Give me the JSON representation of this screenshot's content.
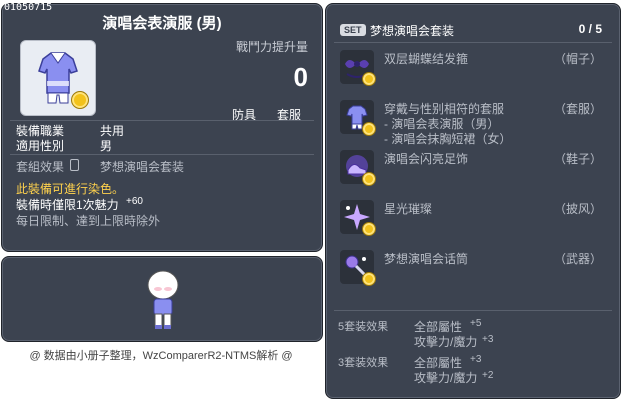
{
  "item": {
    "id_label": "01050715",
    "title": "演唱会表演服 (男)",
    "power_label": "戰鬥力提升量",
    "power_value": "0",
    "tag_1": "防具",
    "tag_2": "套服",
    "info": [
      {
        "label": "裝備職業",
        "value": "共用"
      },
      {
        "label": "適用性別",
        "value": "男"
      }
    ],
    "set_effect_label": "套組效果",
    "set_effect_value": "梦想演唱会套装",
    "dye_note": "此裝備可進行染色。",
    "charm_label": "裝備時僅限1次魅力",
    "charm_value": "+60",
    "limit_note": "每日限制、達到上限時除外"
  },
  "footer": "@ 数据由小册子整理，WzComparerR2-NTMS解析 @",
  "set": {
    "badge": "SET",
    "name": "梦想演唱会套装",
    "count": "0 / 5",
    "items": [
      {
        "name": "双层蝴蝶结发箍",
        "slot": "（帽子）",
        "icon": "bow-headband-icon"
      },
      {
        "name": "穿戴与性别相符的套服",
        "slot": "（套服）",
        "icon": "outfit-icon",
        "sub": [
          "- 演唱会表演服（男）",
          "- 演唱会抹胸短裙（女）"
        ]
      },
      {
        "name": "演唱会闪亮足饰",
        "slot": "（鞋子）",
        "icon": "shoes-icon"
      },
      {
        "name": "星光璀璨",
        "slot": "（披风）",
        "icon": "cape-icon"
      },
      {
        "name": "梦想演唱会话筒",
        "slot": "（武器）",
        "icon": "microphone-icon"
      }
    ],
    "effects": [
      {
        "label": "5套装效果",
        "lines": [
          {
            "stat": "全部屬性",
            "value": "+5"
          },
          {
            "stat": "攻擊力/魔力",
            "value": "+3"
          }
        ]
      },
      {
        "label": "3套装效果",
        "lines": [
          {
            "stat": "全部屬性",
            "value": "+3"
          },
          {
            "stat": "攻擊力/魔力",
            "value": "+2"
          }
        ]
      }
    ]
  }
}
